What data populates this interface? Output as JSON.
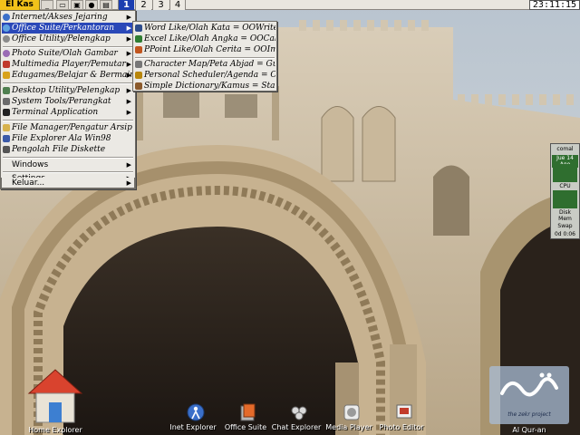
{
  "taskbar": {
    "start_label": "El Kas",
    "workspaces": [
      "1",
      "2",
      "3",
      "4"
    ],
    "active_workspace": "1",
    "clock": "23:11:15"
  },
  "main_menu": {
    "items": [
      {
        "label": "Internet/Akses Jejaring",
        "submenu": true
      },
      {
        "label": "Office Suite/Perkantoran",
        "submenu": true,
        "highlighted": true
      },
      {
        "label": "Office Utility/Pelengkap",
        "submenu": true
      },
      {
        "label": "Photo Suite/Olah Gambar",
        "submenu": true
      },
      {
        "label": "Multimedia Player/Pemutar",
        "submenu": true
      },
      {
        "label": "Edugames/Belajar & Bermain",
        "submenu": true
      },
      {
        "label": "Desktop Utility/Pelengkap",
        "submenu": true
      },
      {
        "label": "System Tools/Perangkat",
        "submenu": true
      },
      {
        "label": "Terminal Application",
        "submenu": true
      },
      {
        "label": "File Manager/Pengatur Arsip",
        "submenu": false
      },
      {
        "label": "File Explorer Ala Win98",
        "submenu": false
      },
      {
        "label": "Pengolah File Diskette",
        "submenu": false
      },
      {
        "label": "Windows",
        "submenu": true
      },
      {
        "label": "Settings",
        "submenu": true
      },
      {
        "label": "Keluar...",
        "submenu": true
      }
    ]
  },
  "sub_menu": {
    "items": [
      {
        "label": "Word Like/Olah Kata = OOWriter"
      },
      {
        "label": "Excel Like/Olah Angka = OOCalc"
      },
      {
        "label": "PPoint Like/Olah Cerita = OOImpress"
      },
      {
        "label": "Character Map/Peta Abjad = GuCharmap"
      },
      {
        "label": "Personal Scheduler/Agenda = OsmO"
      },
      {
        "label": "Simple Dictionary/Kamus = Stardict"
      }
    ]
  },
  "desktop_icons": [
    {
      "label": "Home Explorer",
      "icon": "home-icon"
    },
    {
      "label": "Inet Explorer",
      "icon": "globe-icon"
    },
    {
      "label": "Office Suite",
      "icon": "office-icon"
    },
    {
      "label": "Chat Explorer",
      "icon": "chat-icon"
    },
    {
      "label": "Media Player",
      "icon": "media-icon"
    },
    {
      "label": "Photo Editor",
      "icon": "photo-icon"
    },
    {
      "label": "Al Qur-an",
      "icon": "quran-icon"
    }
  ],
  "zekr": {
    "caption": "the zekr project"
  },
  "monitor": {
    "title": "comal",
    "date": "Jue 14 Ago",
    "cpu_label": "CPU",
    "disk_label": "Disk",
    "mem_label": "Mem",
    "swap_label": "Swap",
    "uptime": "0d 0:06"
  },
  "colors": {
    "start": "#f2c21a",
    "highlight": "#2a48b8",
    "menu_bg": "#ebe9e4"
  }
}
